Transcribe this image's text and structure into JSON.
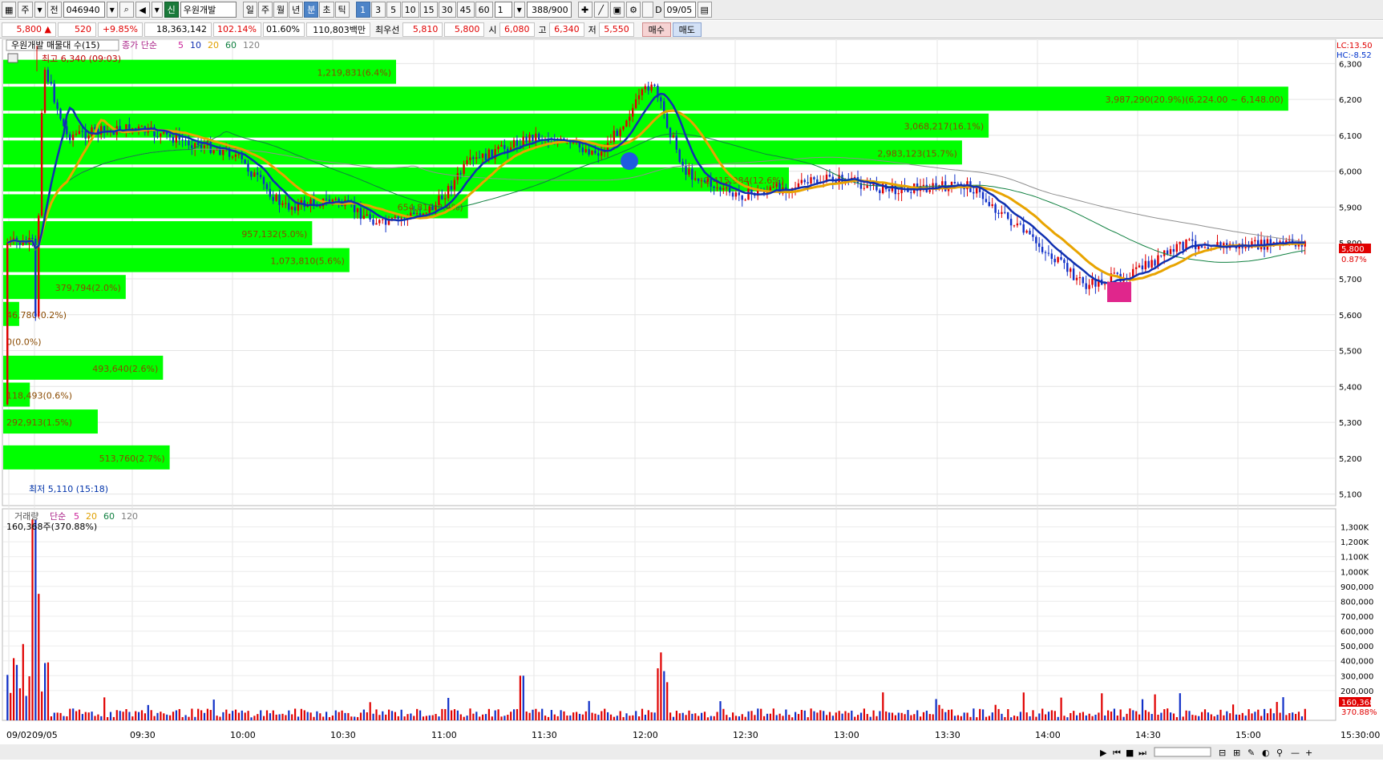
{
  "toolbar": {
    "market": "주",
    "period_type": "전",
    "code": "046940",
    "badge": "신",
    "stock_name": "우원개발",
    "periods": [
      "일",
      "주",
      "월",
      "년",
      "분",
      "초",
      "틱"
    ],
    "active_period": "분",
    "intervals": [
      "1",
      "3",
      "5",
      "10",
      "15",
      "30",
      "45",
      "60"
    ],
    "active_interval": "1",
    "interval_value": "1",
    "count": "388/900",
    "date_check": "D",
    "date": "09/05"
  },
  "quote": {
    "price": "5,800",
    "arrow": "▲",
    "change": "520",
    "change_pct": "+9.85%",
    "volume": "18,363,142",
    "vol_ratio": "102.14%",
    "turnover": "01.60%",
    "amount": "110,803백만",
    "best_ask_label": "최우선",
    "best_ask": "5,810",
    "best_bid": "5,800",
    "open_label": "시",
    "open": "6,080",
    "high_label": "고",
    "high": "6,340",
    "low_label": "저",
    "low": "5,550",
    "buy_label": "매수",
    "sell_label": "매도"
  },
  "price_panel": {
    "legend_title": "우원개발 매물대 수(15)",
    "legend_ma": "종가 단순",
    "ma_periods": [
      "5",
      "10",
      "20",
      "60",
      "120"
    ],
    "ma_colors": [
      "#cc2299",
      "#1030b0",
      "#e0a000",
      "#108040",
      "#808080"
    ],
    "lc": "LC:13.50",
    "hc": "HC:-8.52",
    "high_marker": "최고 6,340 (09:03)",
    "low_marker": "최저 5,110 (15:18)",
    "current_tag": "5,800",
    "current_pct": "0.87%",
    "y_ticks": [
      "6,300",
      "6,200",
      "6,100",
      "6,000",
      "5,900",
      "5,800",
      "5,700",
      "5,600",
      "5,500",
      "5,400",
      "5,300",
      "5,200",
      "5,100"
    ],
    "volume_profile": [
      {
        "label": "513,760(2.7%)",
        "price": 5200,
        "width": 0.125
      },
      {
        "label": "292,913(1.5%)",
        "price": 5300,
        "width": 0.071
      },
      {
        "label": "118,493(0.6%)",
        "price": 5375,
        "width": 0.02
      },
      {
        "label": "493,640(2.6%)",
        "price": 5450,
        "width": 0.12
      },
      {
        "label": "0(0.0%)",
        "price": 5525,
        "width": 0
      },
      {
        "label": "46,780(0.2%)",
        "price": 5600,
        "width": 0.012
      },
      {
        "label": "379,794(2.0%)",
        "price": 5675,
        "width": 0.092
      },
      {
        "label": "1,073,810(5.6%)",
        "price": 5750,
        "width": 0.26
      },
      {
        "label": "957,132(5.0%)",
        "price": 5825,
        "width": 0.232
      },
      {
        "label": "654,819(3.4%)",
        "price": 5900,
        "width": 0.349
      },
      {
        "label": "2,415,984(12.6%)",
        "price": 5975,
        "width": 0.59
      },
      {
        "label": "2,983,123(15.7%)",
        "price": 6050,
        "width": 0.72
      },
      {
        "label": "3,068,217(16.1%)",
        "price": 6125,
        "width": 0.74
      },
      {
        "label": "3,987,290(20.9%)(6,224.00 ~ 6,148.00)",
        "price": 6200,
        "width": 0.965
      },
      {
        "label": "1,219,831(6.4%)",
        "price": 6275,
        "width": 0.295
      }
    ]
  },
  "volume_panel": {
    "legend_title": "거래량",
    "legend_ma": "단순",
    "ma_periods": [
      "5",
      "20",
      "60",
      "120"
    ],
    "info": "160,368주(370.88%)",
    "y_ticks": [
      "1,300K",
      "1,200K",
      "1,100K",
      "1,000K",
      "900,000",
      "800,000",
      "700,000",
      "600,000",
      "500,000",
      "400,000",
      "300,000",
      "200,000"
    ],
    "current_tag": "160,368",
    "current_pct": "370.88%"
  },
  "time_axis": {
    "labels": [
      "09/02",
      "09/05",
      "09:30",
      "10:00",
      "10:30",
      "11:00",
      "11:30",
      "12:00",
      "12:30",
      "13:00",
      "13:30",
      "14:00",
      "14:30",
      "15:00"
    ],
    "right_label": "15:30:00"
  },
  "chart_data": {
    "type": "candlestick",
    "price_range": [
      5050,
      6350
    ],
    "close_series_approx": [
      {
        "time": "09:00",
        "close": 5350
      },
      {
        "time": "09:03",
        "close": 6300
      },
      {
        "time": "09:10",
        "close": 6100
      },
      {
        "time": "09:30",
        "close": 6120
      },
      {
        "time": "10:00",
        "close": 6050
      },
      {
        "time": "10:15",
        "close": 5900
      },
      {
        "time": "10:30",
        "close": 5920
      },
      {
        "time": "10:45",
        "close": 5850
      },
      {
        "time": "11:00",
        "close": 5900
      },
      {
        "time": "11:10",
        "close": 6020
      },
      {
        "time": "11:30",
        "close": 6100
      },
      {
        "time": "11:50",
        "close": 6050
      },
      {
        "time": "12:05",
        "close": 6250
      },
      {
        "time": "12:15",
        "close": 6000
      },
      {
        "time": "12:30",
        "close": 5930
      },
      {
        "time": "13:00",
        "close": 5980
      },
      {
        "time": "13:15",
        "close": 5950
      },
      {
        "time": "13:40",
        "close": 5960
      },
      {
        "time": "14:00",
        "close": 5800
      },
      {
        "time": "14:15",
        "close": 5680
      },
      {
        "time": "14:30",
        "close": 5720
      },
      {
        "time": "14:45",
        "close": 5800
      },
      {
        "time": "15:00",
        "close": 5790
      },
      {
        "time": "15:18",
        "close": 5800
      }
    ]
  },
  "footer": {
    "icons": [
      "play-icon",
      "first-icon",
      "stop-icon",
      "last-icon"
    ]
  }
}
